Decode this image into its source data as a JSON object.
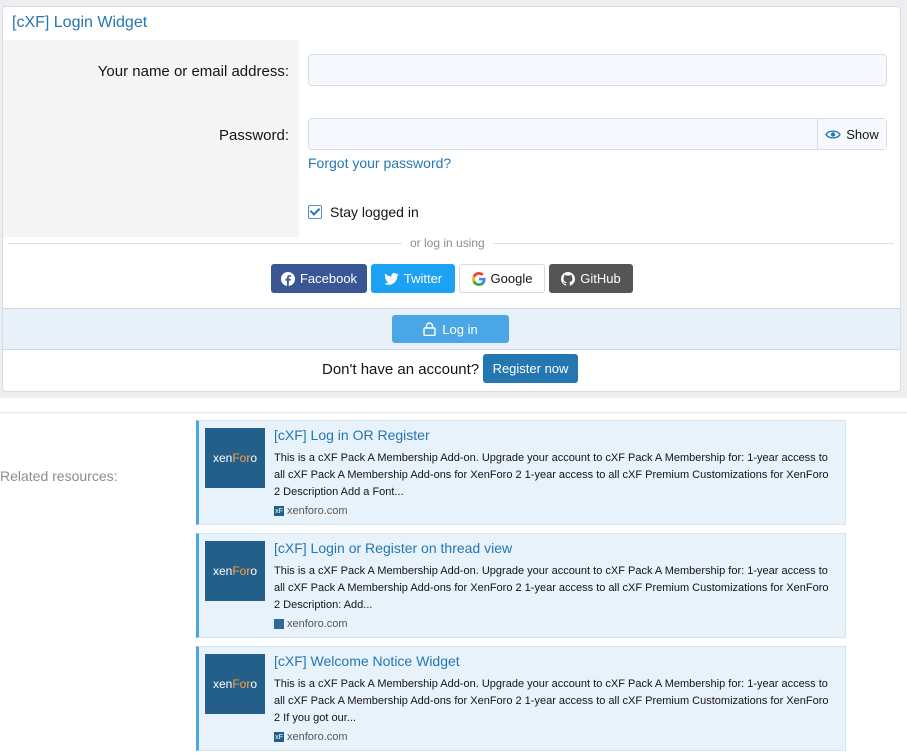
{
  "widget": {
    "title": "[cXF] Login Widget",
    "name_label": "Your name or email address:",
    "name_value": "",
    "password_label": "Password:",
    "password_value": "",
    "show_label": "Show",
    "forgot_label": "Forgot your password?",
    "stay_label": "Stay logged in",
    "stay_checked": true,
    "or_text": "or log in using",
    "social": [
      {
        "label": "Facebook",
        "icon": "facebook-icon"
      },
      {
        "label": "Twitter",
        "icon": "twitter-icon"
      },
      {
        "label": "Google",
        "icon": "google-icon"
      },
      {
        "label": "GitHub",
        "icon": "github-icon"
      }
    ],
    "login_label": "Log in",
    "no_account_text": "Don't have an account?",
    "register_label": "Register now"
  },
  "related": {
    "label": "Related resources:",
    "items": [
      {
        "title": "[cXF] Log in OR Register",
        "desc": "This is a cXF Pack A Membership Add-on. Upgrade your account to cXF Pack A Membership for: 1-year access to all cXF Pack A Membership Add-ons for XenForo 2 1-year access to all cXF Premium Customizations for XenForo 2 Description Add a Font...",
        "domain": "xenforo.com",
        "favicon": "xF"
      },
      {
        "title": "[cXF] Login or Register on thread view",
        "desc": "This is a cXF Pack A Membership Add-on. Upgrade your account to cXF Pack A Membership for: 1-year access to all cXF Pack A Membership Add-ons for XenForo 2 1-year access to all cXF Premium Customizations for XenForo 2 Description: Add...",
        "domain": "xenforo.com",
        "favicon": ""
      },
      {
        "title": "[cXF] Welcome Notice Widget",
        "desc": "This is a cXF Pack A Membership Add-on. Upgrade your account to cXF Pack A Membership for: 1-year access to all cXF Pack A Membership Add-ons for XenForo 2 1-year access to all cXF Premium Customizations for XenForo 2 If you got our...",
        "domain": "xenforo.com",
        "favicon": "xF"
      }
    ],
    "thumb_text_a": "xen",
    "thumb_text_b": "For",
    "thumb_text_c": "o"
  },
  "colors": {
    "link": "#2577b1",
    "facebook": "#3a5795",
    "twitter": "#1da1f2",
    "github": "#555555",
    "login": "#4ba6e5"
  }
}
